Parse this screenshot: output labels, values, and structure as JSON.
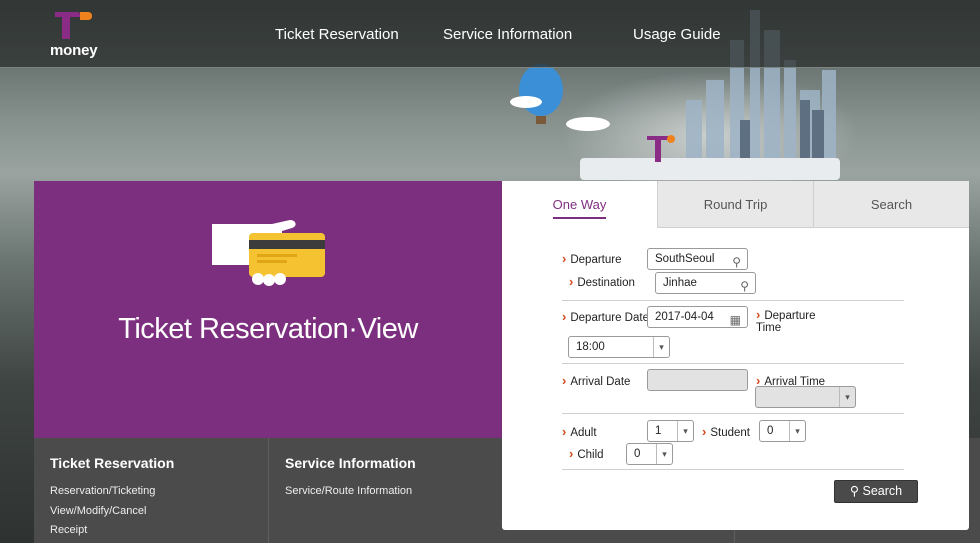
{
  "brand": {
    "logo_text": "money",
    "colors": {
      "purple": "#7d2f7f",
      "orange": "#f0821e",
      "accent_arrow": "#d54a1a"
    }
  },
  "nav": {
    "items": [
      "Ticket Reservation",
      "Service Information",
      "Usage Guide"
    ]
  },
  "hero": {
    "title": "Ticket Reservation·View",
    "icon": "hand-card-icon"
  },
  "tabs": [
    {
      "label": "One Way",
      "active": true
    },
    {
      "label": "Round Trip",
      "active": false
    },
    {
      "label": "Search",
      "active": false
    }
  ],
  "form": {
    "departure": {
      "label": "Departure",
      "value": "SouthSeoul"
    },
    "destination": {
      "label": "Destination",
      "value": "Jinhae"
    },
    "departure_date": {
      "label": "Departure Date",
      "value": "2017-04-04"
    },
    "departure_time": {
      "label": "Departure Time",
      "value": "18:00"
    },
    "arrival_date": {
      "label": "Arrival Date",
      "value": ""
    },
    "arrival_time": {
      "label": "Arrival Time",
      "value": ""
    },
    "adult": {
      "label": "Adult",
      "value": "1"
    },
    "student": {
      "label": "Student",
      "value": "0"
    },
    "child": {
      "label": "Child",
      "value": "0"
    },
    "search_button": "Search"
  },
  "bottom_menu": [
    {
      "title": "Ticket Reservation",
      "links": [
        "Reservation/Ticketing",
        "View/Modify/Cancel",
        "Receipt"
      ]
    },
    {
      "title": "Service Information",
      "links": [
        "Service/Route Information"
      ]
    }
  ]
}
